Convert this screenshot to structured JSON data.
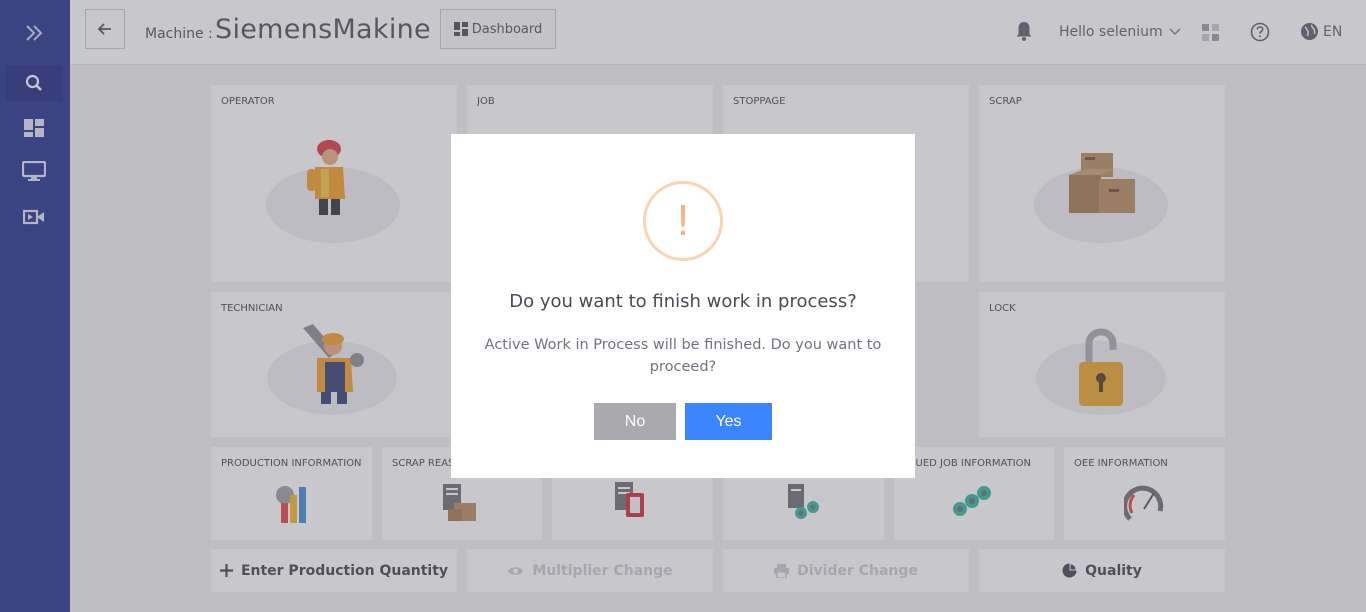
{
  "header": {
    "machine_label": "Machine :",
    "machine_name": "SiemensMakine",
    "dashboard_label": "Dashboard",
    "user_greeting": "Hello selenium",
    "language": "EN"
  },
  "tiles": {
    "operator": "OPERATOR",
    "job": "JOB",
    "stoppage": "STOPPAGE",
    "scrap": "SCRAP",
    "technician": "TECHNICIAN",
    "lock": "LOCK",
    "production_information": "PRODUCTION INFORMATION",
    "scrap_reason": "SCRAP REASON",
    "queued_job_information": "QUEUED JOB INFORMATION",
    "oee_information": "OEE INFORMATION"
  },
  "actions": {
    "enter_production_quantity": "Enter Production Quantity",
    "multiplier_change": "Multiplier Change",
    "divider_change": "Divider Change",
    "quality": "Quality"
  },
  "modal": {
    "title": "Do you want to finish work in process?",
    "message": "Active Work in Process will be finished. Do you want to proceed?",
    "no_label": "No",
    "yes_label": "Yes",
    "icon_symbol": "!"
  },
  "colors": {
    "sidebar": "#1b2a8a",
    "primary": "#3b86ff",
    "secondary": "#a9a9ae",
    "warning": "#f3b683"
  }
}
